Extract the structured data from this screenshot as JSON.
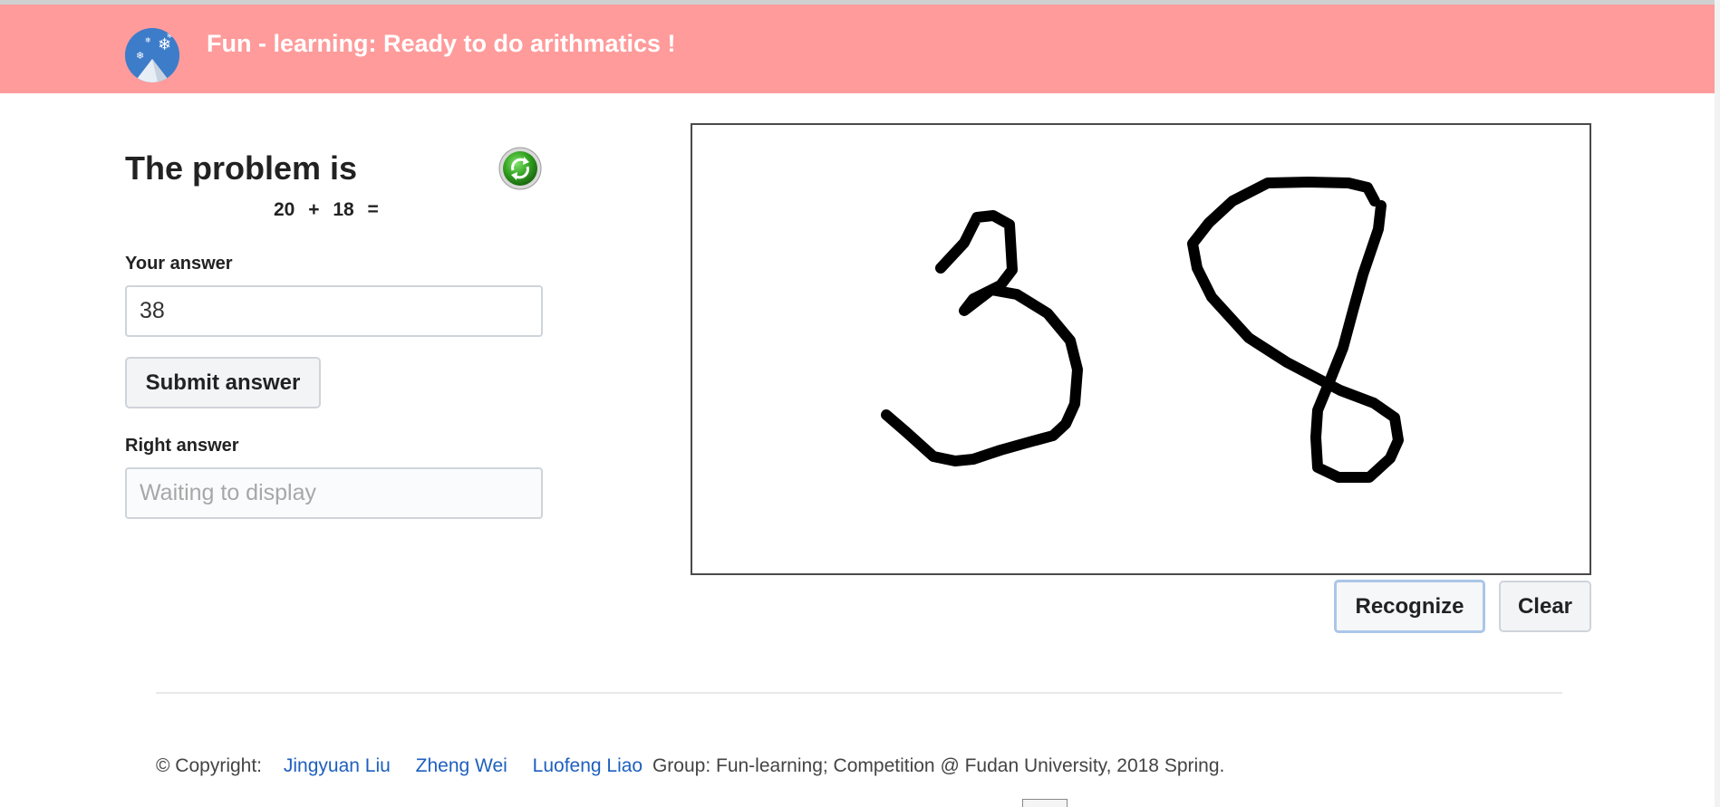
{
  "header": {
    "title": "Fun - learning: Ready to do arithmatics !",
    "logo_icon": "snowflake-mountain-logo",
    "background_color": "#ff9b9b"
  },
  "problem": {
    "heading": "The problem is",
    "refresh_icon": "refresh-icon",
    "operand_a": "20",
    "operator": "+",
    "operand_b": "18",
    "equals": "="
  },
  "answer": {
    "label": "Your answer",
    "value": "38"
  },
  "submit": {
    "label": "Submit answer"
  },
  "right_answer": {
    "label": "Right answer",
    "placeholder": "Waiting to display"
  },
  "canvas": {
    "handwritten_content": "38",
    "recognize_label": "Recognize",
    "clear_label": "Clear"
  },
  "footer": {
    "copyright": "© Copyright:",
    "authors": [
      "Jingyuan Liu",
      "Zheng Wei",
      "Luofeng Liao"
    ],
    "group_text": "Group: Fun-learning; Competition @ Fudan University, 2018 Spring."
  }
}
